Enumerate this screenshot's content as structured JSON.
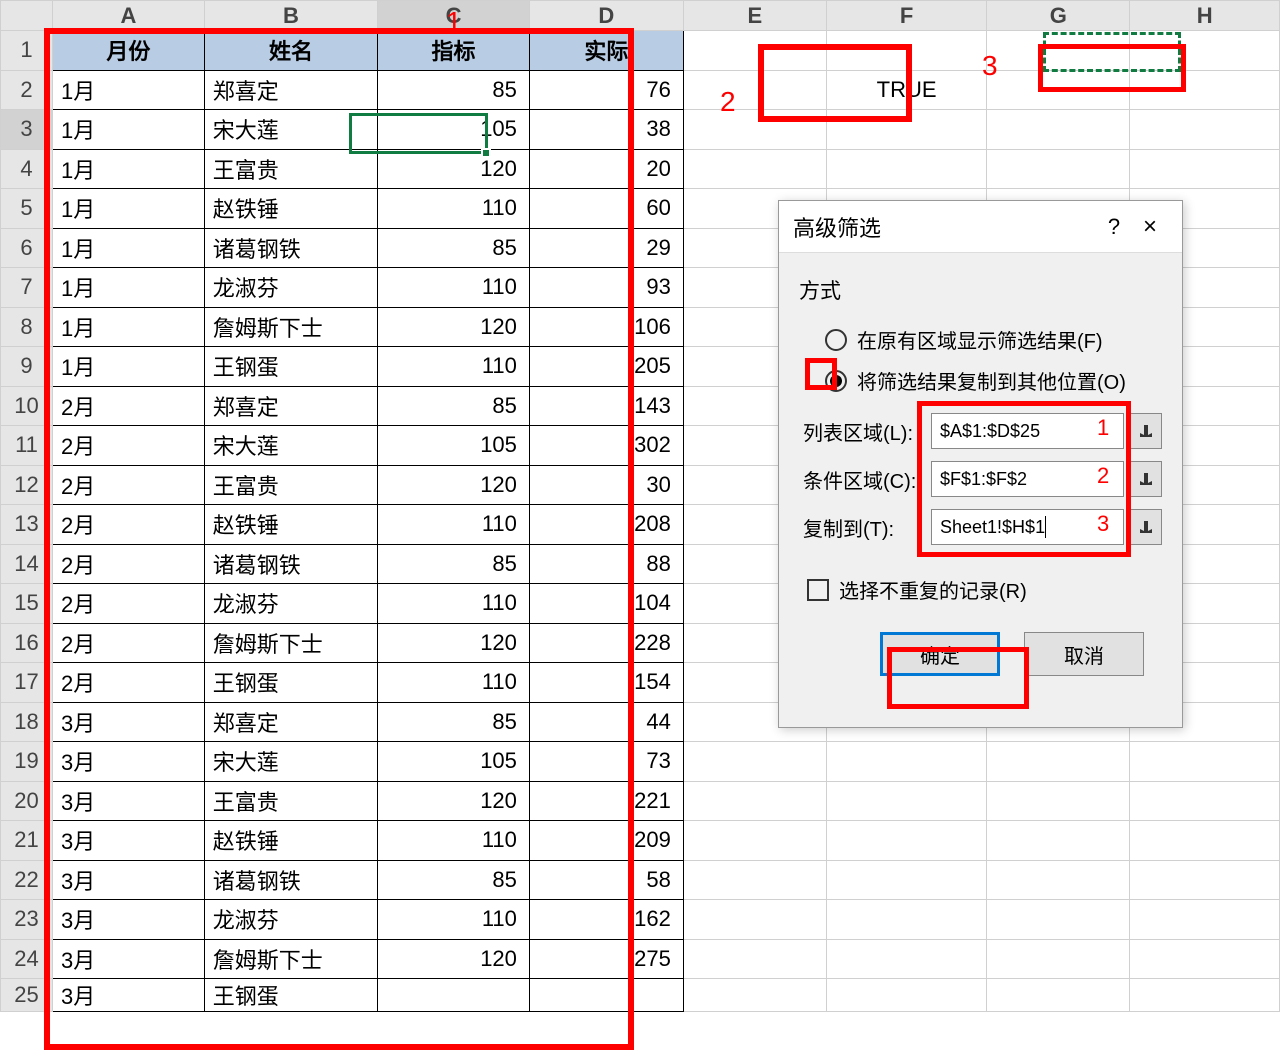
{
  "columns": [
    "A",
    "B",
    "C",
    "D",
    "E",
    "F",
    "G",
    "H"
  ],
  "table": {
    "headers": [
      "月份",
      "姓名",
      "指标",
      "实际"
    ],
    "rows": [
      [
        "1月",
        "郑喜定",
        "85",
        "76"
      ],
      [
        "1月",
        "宋大莲",
        "105",
        "38"
      ],
      [
        "1月",
        "王富贵",
        "120",
        "20"
      ],
      [
        "1月",
        "赵铁锤",
        "110",
        "60"
      ],
      [
        "1月",
        "诸葛钢铁",
        "85",
        "29"
      ],
      [
        "1月",
        "龙淑芬",
        "110",
        "93"
      ],
      [
        "1月",
        "詹姆斯下士",
        "120",
        "106"
      ],
      [
        "1月",
        "王钢蛋",
        "110",
        "205"
      ],
      [
        "2月",
        "郑喜定",
        "85",
        "143"
      ],
      [
        "2月",
        "宋大莲",
        "105",
        "302"
      ],
      [
        "2月",
        "王富贵",
        "120",
        "30"
      ],
      [
        "2月",
        "赵铁锤",
        "110",
        "208"
      ],
      [
        "2月",
        "诸葛钢铁",
        "85",
        "88"
      ],
      [
        "2月",
        "龙淑芬",
        "110",
        "104"
      ],
      [
        "2月",
        "詹姆斯下士",
        "120",
        "228"
      ],
      [
        "2月",
        "王钢蛋",
        "110",
        "154"
      ],
      [
        "3月",
        "郑喜定",
        "85",
        "44"
      ],
      [
        "3月",
        "宋大莲",
        "105",
        "73"
      ],
      [
        "3月",
        "王富贵",
        "120",
        "221"
      ],
      [
        "3月",
        "赵铁锤",
        "110",
        "209"
      ],
      [
        "3月",
        "诸葛钢铁",
        "85",
        "58"
      ],
      [
        "3月",
        "龙淑芬",
        "110",
        "162"
      ],
      [
        "3月",
        "詹姆斯下士",
        "120",
        "275"
      ]
    ],
    "partial_row_25": [
      "3月",
      "王钢蛋"
    ]
  },
  "cell_F2": "TRUE",
  "annotations": {
    "a1": "1",
    "a2": "2",
    "a3": "3"
  },
  "dialog": {
    "title": "高级筛选",
    "help": "?",
    "close": "×",
    "method_label": "方式",
    "radio1": "在原有区域显示筛选结果(F)",
    "radio2": "将筛选结果复制到其他位置(O)",
    "list_label": "列表区域(L):",
    "list_value": "$A$1:$D$25",
    "crit_label": "条件区域(C):",
    "crit_value": "$F$1:$F$2",
    "copy_label": "复制到(T):",
    "copy_value": "Sheet1!$H$1",
    "unique_label": "选择不重复的记录(R)",
    "ok": "确定",
    "cancel": "取消",
    "num1": "1",
    "num2": "2",
    "num3": "3"
  }
}
